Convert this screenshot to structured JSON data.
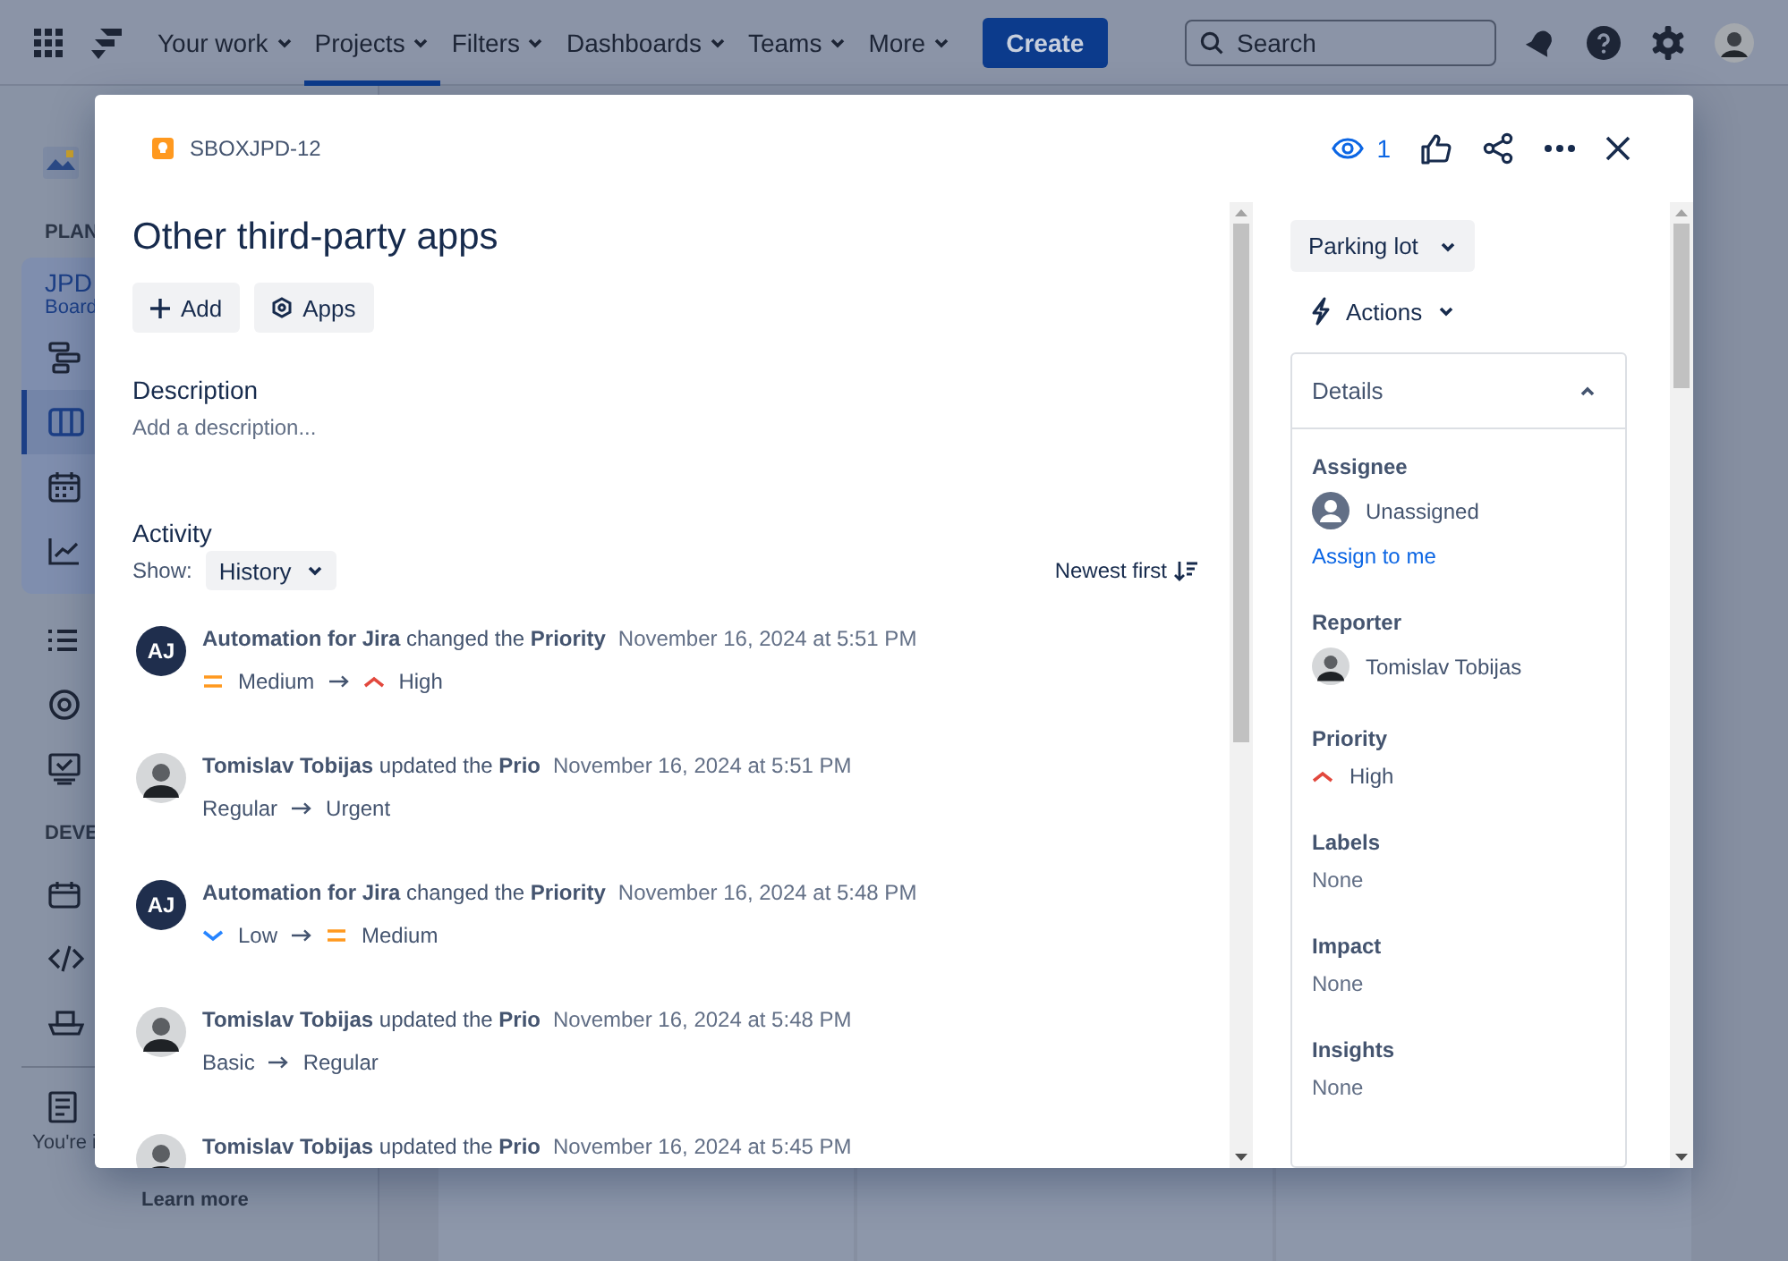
{
  "nav": {
    "items": [
      {
        "label": "Your work",
        "selected": false
      },
      {
        "label": "Projects",
        "selected": true
      },
      {
        "label": "Filters",
        "selected": false
      },
      {
        "label": "Dashboards",
        "selected": false
      },
      {
        "label": "Teams",
        "selected": false
      },
      {
        "label": "More",
        "selected": false
      }
    ],
    "create": "Create",
    "search": {
      "placeholder": "Search"
    }
  },
  "sidebar": {
    "section_1": "PLAN",
    "project": {
      "name": "JPD",
      "subtitle": "Board"
    },
    "project_icons": [
      {
        "kind": "timeline",
        "selected": false
      },
      {
        "kind": "board",
        "selected": true
      },
      {
        "kind": "calendar",
        "selected": false
      },
      {
        "kind": "chart",
        "selected": false
      }
    ],
    "icons": [
      {
        "kind": "list",
        "selected": false
      },
      {
        "kind": "target",
        "selected": false
      },
      {
        "kind": "monitor",
        "selected": false
      }
    ],
    "section_2": "DEVE",
    "dev_icons": [
      {
        "kind": "release",
        "selected": false
      },
      {
        "kind": "code",
        "selected": false
      },
      {
        "kind": "ship",
        "selected": false
      }
    ],
    "footer_icon": {
      "kind": "page",
      "selected": false
    },
    "footer_text": "You're i",
    "footer_link": "Learn more"
  },
  "modal": {
    "key": "SBOXJPD-12",
    "watchers": "1",
    "title": "Other third-party apps",
    "buttons": [
      {
        "kind": "add",
        "label": "Add"
      },
      {
        "kind": "apps",
        "label": "Apps"
      }
    ],
    "description": {
      "label": "Description",
      "placeholder": "Add a description..."
    },
    "activity": {
      "heading": "Activity",
      "show_label": "Show:",
      "filter": "History",
      "sort": "Newest first",
      "entries": [
        {
          "kind": "initials",
          "initials": "AJ",
          "text": "**Automation for Jira** changed the **Priority**",
          "time": "November 16, 2024 at 5:51 PM",
          "from": {
            "label": "Medium",
            "icon": {
              "kind": "medium"
            }
          },
          "to": {
            "label": "High",
            "icon": {
              "kind": "high"
            }
          }
        },
        {
          "kind": "photo",
          "text": "**Tomislav Tobijas** updated the **Prio**",
          "time": "November 16, 2024 at 5:51 PM",
          "from": {
            "label": "Regular"
          },
          "to": {
            "label": "Urgent"
          }
        },
        {
          "kind": "initials",
          "initials": "AJ",
          "text": "**Automation for Jira** changed the **Priority**",
          "time": "November 16, 2024 at 5:48 PM",
          "from": {
            "label": "Low",
            "icon": {
              "kind": "low"
            }
          },
          "to": {
            "label": "Medium",
            "icon": {
              "kind": "medium"
            }
          }
        },
        {
          "kind": "photo",
          "text": "**Tomislav Tobijas** updated the **Prio**",
          "time": "November 16, 2024 at 5:48 PM",
          "from": {
            "label": "Basic"
          },
          "to": {
            "label": "Regular"
          }
        },
        {
          "kind": "photo",
          "text": "**Tomislav Tobijas** updated the **Prio**",
          "time": "November 16, 2024 at 5:45 PM"
        }
      ]
    },
    "status": "Parking lot",
    "actions": "Actions",
    "details": {
      "heading": "Details",
      "expanded": true,
      "fields": [
        {
          "kind": "assignee",
          "label": "Assignee",
          "value": "Unassigned",
          "link": "Assign to me"
        },
        {
          "kind": "person",
          "label": "Reporter",
          "value": "Tomislav Tobijas"
        },
        {
          "kind": "priority",
          "label": "Priority",
          "value": "High",
          "icon": {
            "kind": "high"
          }
        },
        {
          "kind": "empty",
          "label": "Labels",
          "value": "None"
        },
        {
          "kind": "empty",
          "label": "Impact",
          "value": "None"
        },
        {
          "kind": "empty",
          "label": "Insights",
          "value": "None"
        }
      ]
    }
  }
}
